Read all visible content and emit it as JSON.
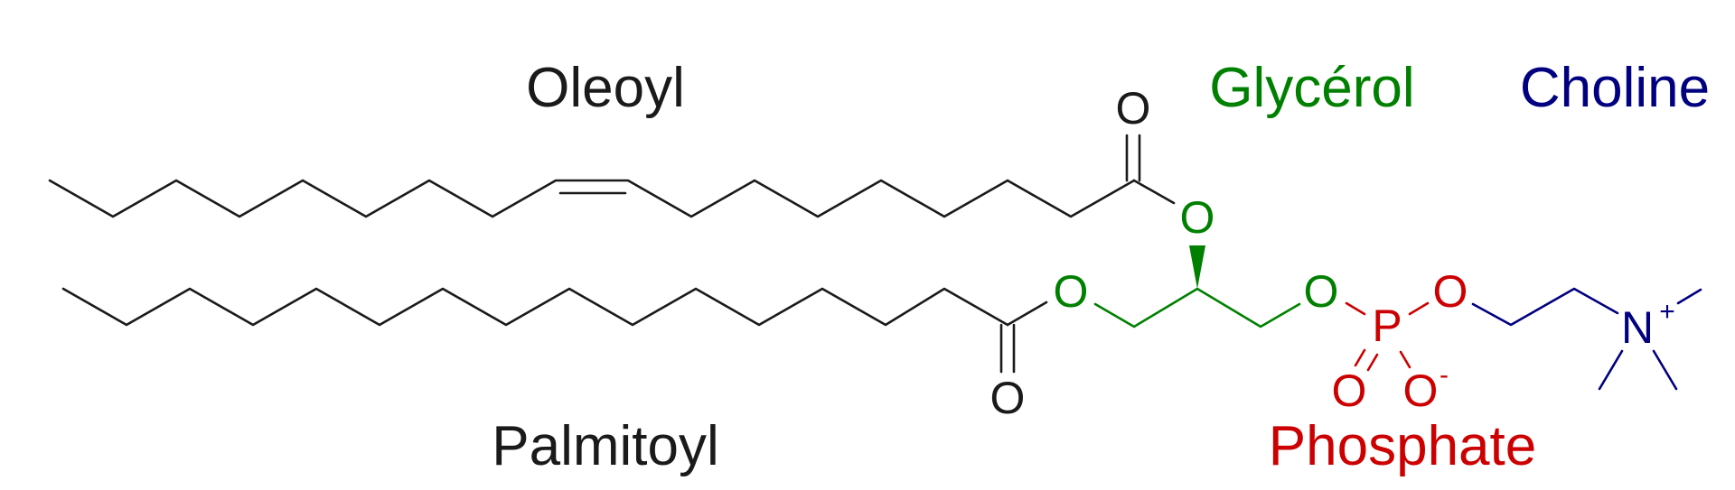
{
  "labels": {
    "oleoyl": "Oleoyl",
    "palmitoyl": "Palmitoyl",
    "glycerol": "Glycérol",
    "choline": "Choline",
    "phosphate": "Phosphate"
  },
  "atoms": {
    "carbonyl_o_top": "O",
    "carbonyl_o_bottom": "O",
    "glycerol_o_center": "O",
    "glycerol_o_left": "O",
    "glycerol_o_right": "O",
    "phosphorus": "P",
    "phosphate_o_right": "O",
    "phosphate_o_double": "O",
    "phosphate_o_minus": "O",
    "phosphate_o_minus_charge": "-",
    "nitrogen": "N",
    "nitrogen_charge": "+"
  },
  "colors": {
    "acyl": "#1a1a1a",
    "glycerol": "#008000",
    "phosphate": "#cc0000",
    "choline": "#000080"
  }
}
